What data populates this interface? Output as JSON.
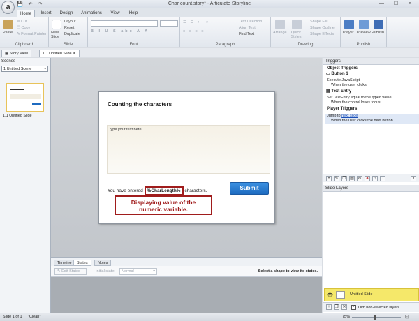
{
  "window": {
    "title": "Char count.story* - Articulate Storyline",
    "app_letter": "a"
  },
  "ribbon_tabs": [
    "Home",
    "Insert",
    "Design",
    "Animations",
    "View",
    "Help"
  ],
  "ribbon": {
    "clipboard": {
      "paste": "Paste",
      "cut": "Cut",
      "copy": "Copy",
      "format_painter": "Format Painter",
      "label": "Clipboard"
    },
    "slide": {
      "new_slide": "New Slide",
      "layout": "Layout",
      "reset": "Reset",
      "duplicate": "Duplicate",
      "label": "Slide"
    },
    "font": {
      "label": "Font"
    },
    "paragraph": {
      "text_direction": "Text Direction",
      "align_text": "Align Text",
      "find_text": "Find Text",
      "label": "Paragraph"
    },
    "drawing": {
      "arrange": "Arrange",
      "quick_styles": "Quick Styles",
      "shape_fill": "Shape Fill",
      "shape_outline": "Shape Outline",
      "shape_effects": "Shape Effects",
      "label": "Drawing"
    },
    "publish": {
      "player": "Player",
      "preview": "Preview",
      "publish": "Publish",
      "label": "Publish"
    }
  },
  "doc_tabs": [
    "Story View",
    "1.1 Untitled Slide"
  ],
  "scenes": {
    "header": "Scenes",
    "selected_scene": "1 Untitled Scene",
    "thumb_label": "1.1 Untitled Slide"
  },
  "slide": {
    "title": "Counting the characters",
    "entry_placeholder": "type your text here",
    "entered_prefix": "You have entered",
    "variable_ref": "%CharLength%",
    "entered_suffix": "characters.",
    "submit_label": "Submit"
  },
  "callout": {
    "line1": "Displaying value of the",
    "line2": "numeric variable."
  },
  "states_panel": {
    "tabs": [
      "Timeline",
      "States",
      "Notes"
    ],
    "edit_states": "Edit States",
    "initial_state_label": "Initial state:",
    "initial_state_value": "Normal",
    "hint": "Select a shape to view its states."
  },
  "triggers": {
    "header": "Triggers",
    "object_triggers": "Object Triggers",
    "button_name": "Button 1",
    "t1_action": "Execute JavaScript",
    "t1_when": "When the user clicks",
    "entry_name": "Text Entry",
    "t2_action": "Set TextEntry equal to the typed value",
    "t2_when": "When the control loses focus",
    "player_triggers": "Player Triggers",
    "t3_action_prefix": "Jump to",
    "t3_link": "next slide",
    "t3_when": "When the user clicks the next button"
  },
  "layers": {
    "header": "Slide Layers",
    "layer_name": "Untitled Slide",
    "dim_label": "Dim non-selected layers"
  },
  "status": {
    "slide_of": "Slide 1 of 1",
    "theme": "\"Clean\"",
    "zoom": "75%"
  },
  "colors": {
    "accent_blue": "#1e6bc0",
    "callout_red": "#a01c1c",
    "layer_yellow": "#f5e86a"
  }
}
